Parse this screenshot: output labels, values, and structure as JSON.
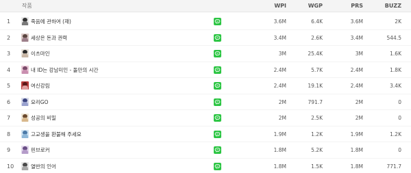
{
  "columns": {
    "title": "작품",
    "wpi": "WPI",
    "wgp": "WGP",
    "prs": "PRS",
    "buzz": "BUZZ"
  },
  "rows": [
    {
      "rank": "1",
      "title": "죽음에 관하여 (재)",
      "wpi": "3.6M",
      "wgp": "6.4K",
      "prs": "3.6M",
      "buzz": "2K",
      "thumb": [
        "#e9e9e9",
        "#333333",
        "#7a7a7a"
      ]
    },
    {
      "rank": "2",
      "title": "세상은 돈과 권력",
      "wpi": "3.4M",
      "wgp": "2.6K",
      "prs": "3.4M",
      "buzz": "544.5",
      "thumb": [
        "#d9c7c4",
        "#5a4540",
        "#9d7f8a"
      ]
    },
    {
      "rank": "3",
      "title": "이츠마인",
      "wpi": "3M",
      "wgp": "25.4K",
      "prs": "3M",
      "buzz": "1.6K",
      "thumb": [
        "#e8e2da",
        "#2a2a2a",
        "#c9b7a6"
      ]
    },
    {
      "rank": "4",
      "title": "내 ID는 강남미인 - 돌만의 시간",
      "wpi": "2.4M",
      "wgp": "5.7K",
      "prs": "2.4M",
      "buzz": "1.8K",
      "thumb": [
        "#e9c9d6",
        "#7b4b6a",
        "#c98fb0"
      ]
    },
    {
      "rank": "5",
      "title": "여신강림",
      "wpi": "2.4M",
      "wgp": "19.1K",
      "prs": "2.4M",
      "buzz": "3.4K",
      "thumb": [
        "#b83a3a",
        "#5a1a1a",
        "#e0a0a0"
      ]
    },
    {
      "rank": "6",
      "title": "요리GO",
      "wpi": "2M",
      "wgp": "791.7",
      "prs": "2M",
      "buzz": "0",
      "thumb": [
        "#d6d9ea",
        "#3d4680",
        "#9aa2cf"
      ]
    },
    {
      "rank": "7",
      "title": "성공의 비밀",
      "wpi": "2M",
      "wgp": "2.5K",
      "prs": "2M",
      "buzz": "0",
      "thumb": [
        "#efe6d6",
        "#6b4a2e",
        "#d8b88c"
      ]
    },
    {
      "rank": "8",
      "title": "고교생을 환불해 주세요",
      "wpi": "1.9M",
      "wgp": "1.2K",
      "prs": "1.9M",
      "buzz": "1.2K",
      "thumb": [
        "#cfe3f2",
        "#4b7aa8",
        "#8fb8d9"
      ]
    },
    {
      "rank": "9",
      "title": "핀브로커",
      "wpi": "1.8M",
      "wgp": "5.2K",
      "prs": "1.8M",
      "buzz": "0",
      "thumb": [
        "#e3d8ec",
        "#6a4f86",
        "#b59cc9"
      ]
    },
    {
      "rank": "10",
      "title": "열반의 인어",
      "wpi": "1.8M",
      "wgp": "1.5K",
      "prs": "1.8M",
      "buzz": "771.7",
      "thumb": [
        "#e6e6e6",
        "#4a4a4a",
        "#a8a8a8"
      ]
    }
  ],
  "colors": {
    "line_badge": "#2bc542",
    "header_bg": "#f4f4f4"
  },
  "icons": {
    "platform_badge": "line-webtoon-icon"
  }
}
